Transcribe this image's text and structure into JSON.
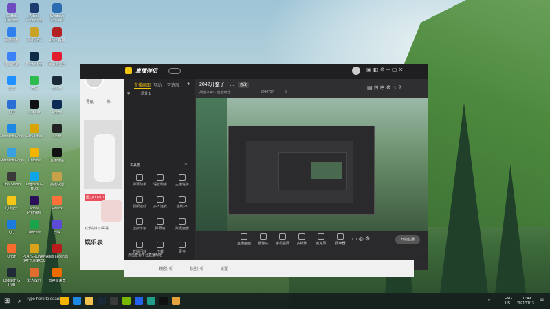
{
  "desktop_icons": [
    {
      "label": "GitHub Desktop",
      "color": "#6e4bbf",
      "col": 0,
      "row": 0
    },
    {
      "label": "Adobe Photoshop",
      "color": "#1d3b6e",
      "col": 1,
      "row": 0
    },
    {
      "label": "Windows Explorer",
      "color": "#2b6cb0",
      "col": 2,
      "row": 0
    },
    {
      "label": "百度网盘",
      "color": "#2f80ed",
      "col": 0,
      "row": 1
    },
    {
      "label": "WeGame",
      "color": "#c9a227",
      "col": 1,
      "row": 1
    },
    {
      "label": "Apex 英雄",
      "color": "#b22222",
      "col": 2,
      "row": 1
    },
    {
      "label": "电脑管家",
      "color": "#3b82f6",
      "col": 0,
      "row": 2
    },
    {
      "label": "Photoshop",
      "color": "#0e2a47",
      "col": 1,
      "row": 2
    },
    {
      "label": "网易云音乐",
      "color": "#e11d2e",
      "col": 2,
      "row": 2
    },
    {
      "label": "迅雷",
      "color": "#1e90ff",
      "col": 0,
      "row": 3
    },
    {
      "label": "微信",
      "color": "#2dbb4d",
      "col": 1,
      "row": 3
    },
    {
      "label": "Steam",
      "color": "#1b2838",
      "col": 2,
      "row": 3
    },
    {
      "label": "QQ",
      "color": "#2a6fd6",
      "col": 0,
      "row": 4
    },
    {
      "label": "CapCut",
      "color": "#111111",
      "col": 1,
      "row": 4
    },
    {
      "label": "Adobe",
      "color": "#0b2a55",
      "col": 2,
      "row": 4
    },
    {
      "label": "Microsoft Edge",
      "color": "#1e88e5",
      "col": 0,
      "row": 5
    },
    {
      "label": "WPS Office",
      "color": "#d9a400",
      "col": 1,
      "row": 5
    },
    {
      "label": "Unity",
      "color": "#222222",
      "col": 2,
      "row": 5
    },
    {
      "label": "Microsoft Edge",
      "color": "#3aa0e0",
      "col": 0,
      "row": 6
    },
    {
      "label": "Chrome",
      "color": "#f4b400",
      "col": 1,
      "row": 6
    },
    {
      "label": "直播伴侣",
      "color": "#111111",
      "col": 2,
      "row": 6
    },
    {
      "label": "OBS Studio",
      "color": "#3a3a3a",
      "col": 0,
      "row": 7
    },
    {
      "label": "Logitech G HUB",
      "color": "#0ea5e9",
      "col": 1,
      "row": 7
    },
    {
      "label": "英雄联盟",
      "color": "#c8a24a",
      "col": 2,
      "row": 7
    },
    {
      "label": "QQ音乐",
      "color": "#f5c518",
      "col": 0,
      "row": 8
    },
    {
      "label": "Adobe Premiere",
      "color": "#2a0f5a",
      "col": 1,
      "row": 8
    },
    {
      "label": "Firefox",
      "color": "#ff7139",
      "col": 2,
      "row": 8
    },
    {
      "label": "QQ",
      "color": "#1d7be0",
      "col": 0,
      "row": 9
    },
    {
      "label": "Tencent",
      "color": "#19a34a",
      "col": 1,
      "row": 9
    },
    {
      "label": "剪映",
      "color": "#5b4bd6",
      "col": 2,
      "row": 9
    },
    {
      "label": "Origin",
      "color": "#f56c2d",
      "col": 0,
      "row": 10
    },
    {
      "label": "PLAYERUNKNOWN'S BATTLEGROUNDS",
      "color": "#d8a21b",
      "col": 1,
      "row": 10
    },
    {
      "label": "Apex Legends",
      "color": "#b91c1c",
      "col": 2,
      "row": 10
    },
    {
      "label": "Logitech G HUB",
      "color": "#1f2937",
      "col": 0,
      "row": 11
    },
    {
      "label": "双人成行",
      "color": "#e06c2d",
      "col": 1,
      "row": 11
    },
    {
      "label": "雷神加速器",
      "color": "#ef6c00",
      "col": 2,
      "row": 11
    }
  ],
  "app": {
    "title": "直播伴侣",
    "version_badge": "",
    "stream_title": "2042开整了. . . .",
    "edit_btn": "修改",
    "game_tag": "战地2042 · 全能射击",
    "stats": "9844727",
    "likes": "0",
    "sidebar_tabs": [
      "直播画面",
      "互动",
      "可选层"
    ],
    "scene_item": "场景 1",
    "tools_title": "工具箱",
    "tools": [
      {
        "label": "弹幕助手",
        "icon": "danmu-icon"
      },
      {
        "label": "语音助手",
        "icon": "voice-icon"
      },
      {
        "label": "主播任务",
        "icon": "task-icon"
      },
      {
        "label": "视频连线",
        "icon": "video-link-icon"
      },
      {
        "label": "多人连麦",
        "icon": "multi-mic-icon"
      },
      {
        "label": "连线PK",
        "icon": "pk-icon"
      },
      {
        "label": "虚拟形象",
        "icon": "avatar-icon"
      },
      {
        "label": "弹幕墙",
        "icon": "wall-icon"
      },
      {
        "label": "数据面板",
        "icon": "data-icon"
      },
      {
        "label": "直播回放",
        "icon": "replay-icon"
      },
      {
        "label": "下载",
        "icon": "download-icon"
      },
      {
        "label": "更多",
        "icon": "more-icon"
      }
    ],
    "notice": "点击查看平台直播规范",
    "bottom_toolbar": [
      {
        "label": "直播画面",
        "icon": "screen-icon"
      },
      {
        "label": "摄像头",
        "icon": "camera-icon"
      },
      {
        "label": "手机投屏",
        "icon": "phone-icon"
      },
      {
        "label": "多媒体",
        "icon": "media-icon"
      },
      {
        "label": "麦克风",
        "icon": "mic-icon"
      },
      {
        "label": "扬声器",
        "icon": "speaker-icon"
      }
    ],
    "start_btn": "开始直播",
    "bottom_strip": [
      "数据分析",
      "粉丝分析",
      "设置"
    ]
  },
  "left_panel": {
    "nav": [
      "导航",
      "推"
    ],
    "tag": "压力TOP10",
    "caption": "欢乐的和小哥哥",
    "category": "娱乐表"
  },
  "taskbar": {
    "search_placeholder": "Type here to search",
    "apps": [
      {
        "name": "chrome",
        "color": "#f4b400"
      },
      {
        "name": "edge",
        "color": "#1e88e5"
      },
      {
        "name": "explorer",
        "color": "#f2c14e"
      },
      {
        "name": "steam",
        "color": "#1b2838"
      },
      {
        "name": "obs",
        "color": "#3a3a3a"
      },
      {
        "name": "geforce",
        "color": "#76b900"
      },
      {
        "name": "teams",
        "color": "#2563eb"
      },
      {
        "name": "terminal",
        "color": "#1f9e89"
      },
      {
        "name": "douyin",
        "color": "#111111"
      },
      {
        "name": "companion",
        "color": "#e6a23c"
      }
    ],
    "lang": "ENG",
    "region": "US",
    "time": "11:49",
    "date": "2021/11/13"
  }
}
